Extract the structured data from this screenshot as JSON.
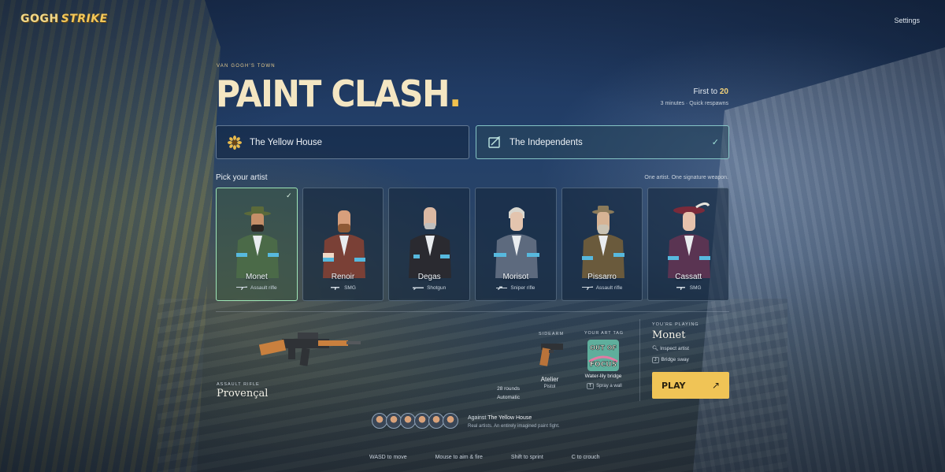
{
  "brand": {
    "part1": "GOGH",
    "part2": "STRIKE"
  },
  "settings_label": "Settings",
  "header": {
    "eyebrow": "VAN GOGH'S TOWN",
    "title": "PAINT CLASH",
    "title_dot": ".",
    "first_to_prefix": "First to",
    "first_to_value": "20",
    "mode_sub": "3 minutes · Quick respawns"
  },
  "teams": [
    {
      "label": "The Yellow House",
      "icon": "sunflower-icon",
      "selected": false
    },
    {
      "label": "The Independents",
      "icon": "easel-icon",
      "selected": true,
      "check": "✓"
    }
  ],
  "pick": {
    "label": "Pick your artist",
    "note": "One artist. One signature weapon."
  },
  "artists": [
    {
      "name": "Monet",
      "weapon": "Assault rifle",
      "selected": true,
      "check": "✓"
    },
    {
      "name": "Renoir",
      "weapon": "SMG",
      "selected": false
    },
    {
      "name": "Degas",
      "weapon": "Shotgun",
      "selected": false
    },
    {
      "name": "Morisot",
      "weapon": "Sniper rifle",
      "selected": false
    },
    {
      "name": "Pissarro",
      "weapon": "Assault rifle",
      "selected": false
    },
    {
      "name": "Cassatt",
      "weapon": "SMG",
      "selected": false
    }
  ],
  "loadout": {
    "weapon_class": "ASSAULT RIFLE",
    "weapon_name": "Provençal",
    "rounds": "28 rounds",
    "fire_mode": "Automatic",
    "sidearm_label": "SIDEARM",
    "sidearm_name": "Atelier",
    "sidearm_type": "Pistol",
    "tag_label": "YOUR ART TAG",
    "tag_name": "Water-lily bridge",
    "tag_key": "T",
    "tag_action": "Spray a wall",
    "tag_art_line1": "OUT OF",
    "tag_art_line2": "FOCUS"
  },
  "playing": {
    "label": "YOU'RE PLAYING",
    "name": "Monet",
    "inspect": "Inspect artist",
    "ability_key": "J",
    "ability": "Bridge sway",
    "play_label": "PLAY",
    "play_arrow": "↗"
  },
  "opponents": {
    "against_prefix": "Against",
    "against_team": "The Yellow House",
    "subtitle": "Real artists. An entirely imagined paint fight.",
    "count": 6
  },
  "controls": [
    "WASD to move",
    "Mouse to aim & fire",
    "Shift to sprint",
    "C to crouch"
  ],
  "colors": {
    "accent": "#f0c456",
    "selected_card_border": "#9fe6b6",
    "selected_team_border": "#96dcd7",
    "title": "#f4e6c2"
  }
}
